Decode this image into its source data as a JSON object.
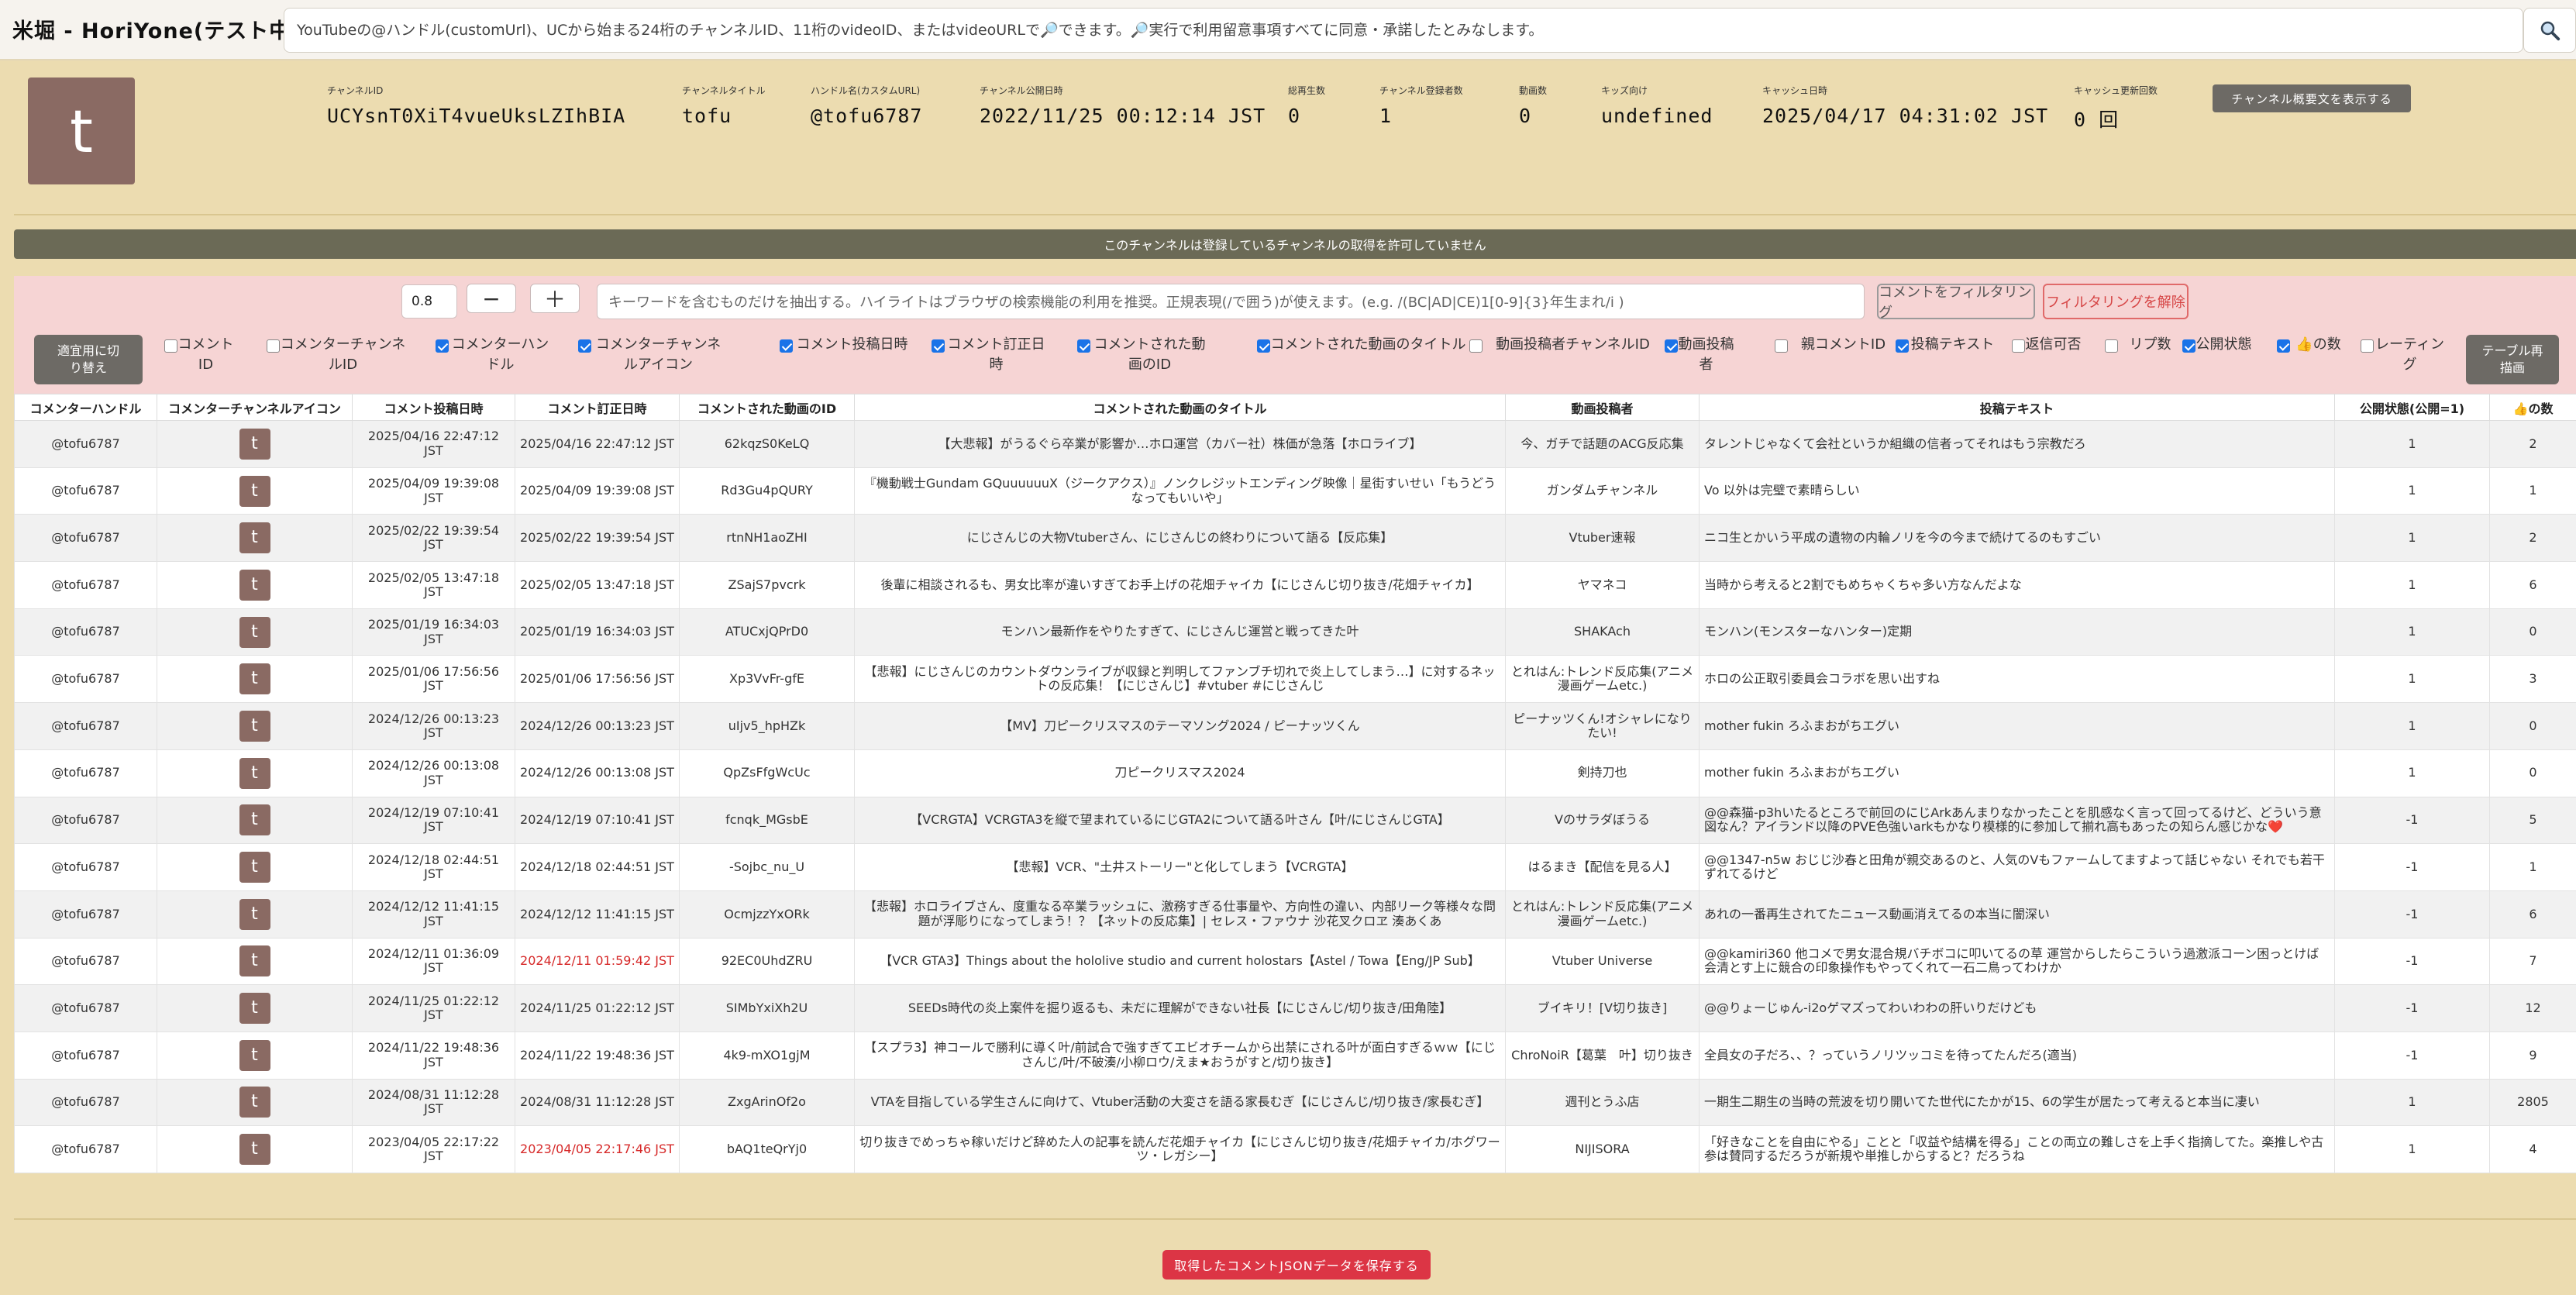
{
  "app": {
    "title": "米堀 - HoriYone(テスト中)"
  },
  "search": {
    "placeholder": "YouTubeの@ハンドル(customUrl)、UCから始まる24桁のチャンネルID、11桁のvideoID、またはvideoURLで🔎できます。🔎実行で利用留意事項すべてに同意・承諾したとみなします。",
    "button_icon": "search-icon"
  },
  "channel": {
    "avatar_letter": "t",
    "fields": [
      {
        "label": "チャンネルID",
        "value": "UCYsnT0XiT4vueUksLZIhBIA"
      },
      {
        "label": "チャンネルタイトル",
        "value": "tofu"
      },
      {
        "label": "ハンドル名(カスタムURL)",
        "value": "@tofu6787"
      },
      {
        "label": "チャンネル公開日時",
        "value": "2022/11/25 00:12:14 JST"
      },
      {
        "label": "総再生数",
        "value": "0"
      },
      {
        "label": "チャンネル登録者数",
        "value": "1"
      },
      {
        "label": "動画数",
        "value": "0"
      },
      {
        "label": "キッズ向け",
        "value": "undefined"
      },
      {
        "label": "キャッシュ日時",
        "value": "2025/04/17 04:31:02 JST"
      },
      {
        "label": "キャッシュ更新回数",
        "value": "0 回"
      }
    ],
    "desc_button": "チャンネル概要文を表示する"
  },
  "notice": "このチャンネルは登録しているチャンネルの取得を許可していません",
  "controls": {
    "zoom_value": "0.8",
    "minus_label": "−",
    "plus_label": "＋",
    "filter_placeholder": "キーワードを含むものだけを抽出する。ハイライトはブラウザの検索機能の利用を推奨。正規表現(/で囲う)が使えます。(e.g. /(BC|AD|CE)1[0-9]{3}年生まれ/i )",
    "filter_button": "コメントをフィルタリング",
    "clear_button": "フィルタリングを解除",
    "switch_button": "適宜用に切り替え",
    "redraw_button": "テーブル再描画"
  },
  "column_toggles": [
    {
      "label": "コメントID",
      "checked": false
    },
    {
      "label": "コメンターチャンネルID",
      "checked": false
    },
    {
      "label": "コメンターハンドル",
      "checked": true
    },
    {
      "label": "コメンターチャンネルアイコン",
      "checked": true
    },
    {
      "label": "コメント投稿日時",
      "checked": true
    },
    {
      "label": "コメント訂正日時",
      "checked": true
    },
    {
      "label": "コメントされた動画のID",
      "checked": true
    },
    {
      "label": "コメントされた動画のタイトル",
      "checked": true
    },
    {
      "label": "動画投稿者チャンネルID",
      "checked": false
    },
    {
      "label": "動画投稿者",
      "checked": true
    },
    {
      "label": "親コメントID",
      "checked": false
    },
    {
      "label": "投稿テキスト",
      "checked": true
    },
    {
      "label": "返信可否",
      "checked": false
    },
    {
      "label": "リプ数",
      "checked": false
    },
    {
      "label": "公開状態",
      "checked": true
    },
    {
      "label": "👍の数",
      "checked": true
    },
    {
      "label": "レーティング",
      "checked": false
    }
  ],
  "table": {
    "headers": [
      "コメンターハンドル",
      "コメンターチャンネルアイコン",
      "コメント投稿日時",
      "コメント訂正日時",
      "コメントされた動画のID",
      "コメントされた動画のタイトル",
      "動画投稿者",
      "投稿テキスト",
      "公開状態(公開=1)",
      "👍の数"
    ],
    "rows": [
      {
        "handle": "@tofu6787",
        "icon": "t",
        "posted": "2025/04/16 22:47:12 JST",
        "edited": "2025/04/16 22:47:12 JST",
        "edited_red": false,
        "video_id": "62kqzS0KeLQ",
        "video_title": "【大悲報】がうるぐら卒業が影響か…ホロ運営（カバー社）株価が急落【ホロライブ】",
        "uploader": "今、ガチで話題のACG反応集",
        "text": "タレントじゃなくて会社というか組織の信者ってそれはもう宗教だろ",
        "status": "1",
        "likes": "2"
      },
      {
        "handle": "@tofu6787",
        "icon": "t",
        "posted": "2025/04/09 19:39:08 JST",
        "edited": "2025/04/09 19:39:08 JST",
        "edited_red": false,
        "video_id": "Rd3Gu4pQURY",
        "video_title": "『機動戦士Gundam GQuuuuuuX（ジークアクス）』ノンクレジットエンディング映像｜星街すいせい「もうどうなってもいいや」",
        "uploader": "ガンダムチャンネル",
        "text": "Vo 以外は完璧で素晴らしい",
        "status": "1",
        "likes": "1"
      },
      {
        "handle": "@tofu6787",
        "icon": "t",
        "posted": "2025/02/22 19:39:54 JST",
        "edited": "2025/02/22 19:39:54 JST",
        "edited_red": false,
        "video_id": "rtnNH1aoZHI",
        "video_title": "にじさんじの大物Vtuberさん、にじさんじの終わりについて語る【反応集】",
        "uploader": "Vtuber速報",
        "text": "ニコ生とかいう平成の遺物の内輪ノリを今の今まで続けてるのもすごい",
        "status": "1",
        "likes": "2"
      },
      {
        "handle": "@tofu6787",
        "icon": "t",
        "posted": "2025/02/05 13:47:18 JST",
        "edited": "2025/02/05 13:47:18 JST",
        "edited_red": false,
        "video_id": "ZSajS7pvcrk",
        "video_title": "後輩に相談されるも、男女比率が違いすぎてお手上げの花畑チャイカ【にじさんじ切り抜き/花畑チャイカ】",
        "uploader": "ヤマネコ",
        "text": "当時から考えると2割でもめちゃくちゃ多い方なんだよな",
        "status": "1",
        "likes": "6"
      },
      {
        "handle": "@tofu6787",
        "icon": "t",
        "posted": "2025/01/19 16:34:03 JST",
        "edited": "2025/01/19 16:34:03 JST",
        "edited_red": false,
        "video_id": "ATUCxjQPrD0",
        "video_title": "モンハン最新作をやりたすぎて、にじさんじ運営と戦ってきた叶",
        "uploader": "SHAKAch",
        "text": "モンハン(モンスターなハンター)定期",
        "status": "1",
        "likes": "0"
      },
      {
        "handle": "@tofu6787",
        "icon": "t",
        "posted": "2025/01/06 17:56:56 JST",
        "edited": "2025/01/06 17:56:56 JST",
        "edited_red": false,
        "video_id": "Xp3VvFr-gfE",
        "video_title": "【悲報】にじさんじのカウントダウンライブが収録と判明してファンブチ切れで炎上してしまう…】に対するネットの反応集！【にじさんじ】#vtuber #にじさんじ",
        "uploader": "とれはん:トレンド反応集(アニメ漫画ゲームetc.)",
        "text": "ホロの公正取引委員会コラボを思い出すね",
        "status": "1",
        "likes": "3"
      },
      {
        "handle": "@tofu6787",
        "icon": "t",
        "posted": "2024/12/26 00:13:23 JST",
        "edited": "2024/12/26 00:13:23 JST",
        "edited_red": false,
        "video_id": "uIjv5_hpHZk",
        "video_title": "【MV】刀ピークリスマスのテーマソング2024 / ピーナッツくん",
        "uploader": "ピーナッツくん!オシャレになりたい!",
        "text": "mother fukin ろふまおがちエグい",
        "status": "1",
        "likes": "0"
      },
      {
        "handle": "@tofu6787",
        "icon": "t",
        "posted": "2024/12/26 00:13:08 JST",
        "edited": "2024/12/26 00:13:08 JST",
        "edited_red": false,
        "video_id": "QpZsFfgWcUc",
        "video_title": "刀ピークリスマス2024",
        "uploader": "剣持刀也",
        "text": "mother fukin ろふまおがちエグい",
        "status": "1",
        "likes": "0"
      },
      {
        "handle": "@tofu6787",
        "icon": "t",
        "posted": "2024/12/19 07:10:41 JST",
        "edited": "2024/12/19 07:10:41 JST",
        "edited_red": false,
        "video_id": "fcnqk_MGsbE",
        "video_title": "【VCRGTA】VCRGTA3を縦で望まれているにじGTA2について語る叶さん【叶/にじさんじGTA】",
        "uploader": "Vのサラダぼうる",
        "text": "@@森猫-p3hいたるところで前回のにじArkあんまりなかったことを肌感なく言って回ってるけど、どういう意図なん？アイランド以降のPVE色強いarkもかなり模様的に参加して揃れ高もあったの知らん感じかな❤️",
        "status": "-1",
        "likes": "5"
      },
      {
        "handle": "@tofu6787",
        "icon": "t",
        "posted": "2024/12/18 02:44:51 JST",
        "edited": "2024/12/18 02:44:51 JST",
        "edited_red": false,
        "video_id": "-Sojbc_nu_U",
        "video_title": "【悲報】VCR、\"土井ストーリー\"と化してしまう【VCRGTA】",
        "uploader": "はるまき【配信を見る人】",
        "text": "@@1347-n5w おじじ沙春と田角が親交あるのと、人気のVもファームしてますよって話じゃない それでも若干ずれてるけど",
        "status": "-1",
        "likes": "1"
      },
      {
        "handle": "@tofu6787",
        "icon": "t",
        "posted": "2024/12/12 11:41:15 JST",
        "edited": "2024/12/12 11:41:15 JST",
        "edited_red": false,
        "video_id": "OcmjzzYxORk",
        "video_title": "【悲報】ホロライブさん、度重なる卒業ラッシュに、激務すぎる仕事量や、方向性の違い、内部リーク等様々な問題が浮彫りになってしまう！？【ネットの反応集】| セレス・ファウナ 沙花叉クロヱ 湊あくあ",
        "uploader": "とれはん:トレンド反応集(アニメ漫画ゲームetc.)",
        "text": "あれの一番再生されてたニュース動画消えてるの本当に闇深い",
        "status": "-1",
        "likes": "6"
      },
      {
        "handle": "@tofu6787",
        "icon": "t",
        "posted": "2024/12/11 01:36:09 JST",
        "edited": "2024/12/11 01:59:42 JST",
        "edited_red": true,
        "video_id": "92EC0UhdZRU",
        "video_title": "【VCR GTA3】Things about the hololive studio and current holostars【Astel / Towa【Eng/JP Sub】",
        "uploader": "Vtuber Universe",
        "text": "@@kamiri360 他コメで男女混合規バチボコに叩いてるの草 運営からしたらこういう過激派コーン困っとけば会清とす上に競合の印象操作もやってくれて一石二鳥ってわけか",
        "status": "-1",
        "likes": "7"
      },
      {
        "handle": "@tofu6787",
        "icon": "t",
        "posted": "2024/11/25 01:22:12 JST",
        "edited": "2024/11/25 01:22:12 JST",
        "edited_red": false,
        "video_id": "SIMbYxiXh2U",
        "video_title": "SEEDs時代の炎上案件を掘り返るも、未だに理解ができない社長【にじさんじ/切り抜き/田角陸】",
        "uploader": "ブイキリ！[V切り抜き]",
        "text": "@@りょーじゅん-i2oゲマズってわいわわの肝いりだけども",
        "status": "-1",
        "likes": "12"
      },
      {
        "handle": "@tofu6787",
        "icon": "t",
        "posted": "2024/11/22 19:48:36 JST",
        "edited": "2024/11/22 19:48:36 JST",
        "edited_red": false,
        "video_id": "4k9-mXO1gjM",
        "video_title": "【スプラ3】神コールで勝利に導く叶/前試合で強すぎてエビオチームから出禁にされる叶が面白すぎるｗｗ【にじさんじ/叶/不破湊/小柳ロウ/えま★おうがすと/切り抜き】",
        "uploader": "ChroNoiR【葛葉　叶】切り抜き",
        "text": "全員女の子だろ、、？っていうノリツッコミを待ってたんだろ(適当)",
        "status": "-1",
        "likes": "9"
      },
      {
        "handle": "@tofu6787",
        "icon": "t",
        "posted": "2024/08/31 11:12:28 JST",
        "edited": "2024/08/31 11:12:28 JST",
        "edited_red": false,
        "video_id": "ZxgArinOf2o",
        "video_title": "VTAを目指している学生さんに向けて、Vtuber活動の大変さを語る家長むぎ【にじさんじ/切り抜き/家長むぎ】",
        "uploader": "週刊とうふ店",
        "text": "一期生二期生の当時の荒波を切り開いてた世代にたかが15、6の学生が居たって考えると本当に凄い",
        "status": "1",
        "likes": "2805"
      },
      {
        "handle": "@tofu6787",
        "icon": "t",
        "posted": "2023/04/05 22:17:22 JST",
        "edited": "2023/04/05 22:17:46 JST",
        "edited_red": true,
        "video_id": "bAQ1teQrYj0",
        "video_title": "切り抜きでめっちゃ稼いだけど辞めた人の記事を読んだ花畑チャイカ【にじさんじ切り抜き/花畑チャイカ/ホグワーツ・レガシー】",
        "uploader": "NIJISORA",
        "text": "「好きなことを自由にやる」ことと「収益や結構を得る」ことの両立の難しさを上手く指摘してた。楽推しや古参は賛同するだろうが新規や単推しからすると？だろうね",
        "status": "1",
        "likes": "4"
      }
    ]
  },
  "footer": {
    "save_button": "取得したコメントJSONデータを保存する"
  }
}
